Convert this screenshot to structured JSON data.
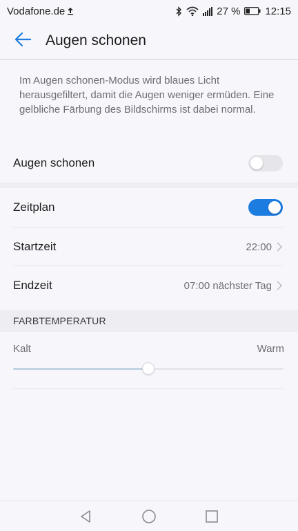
{
  "status_bar": {
    "carrier": "Vodafone.de",
    "battery_percent": "27 %",
    "time": "12:15",
    "icons": [
      "upload-icon",
      "bluetooth-icon",
      "wifi-icon",
      "signal-icon",
      "battery-icon"
    ]
  },
  "app_bar": {
    "back_icon": "arrow-left-icon",
    "title": "Augen schonen"
  },
  "description": "Im Augen schonen-Modus wird blaues Licht herausgefiltert, damit die Augen weniger ermüden. Eine gelbliche Färbung des Bildschirms ist dabei normal.",
  "settings": {
    "eye_comfort": {
      "label": "Augen schonen",
      "enabled": false
    },
    "schedule": {
      "label": "Zeitplan",
      "enabled": true
    },
    "start_time": {
      "label": "Startzeit",
      "value": "22:00"
    },
    "end_time": {
      "label": "Endzeit",
      "value": "07:00 nächster Tag"
    }
  },
  "color_temperature": {
    "header": "FARBTEMPERATUR",
    "min_label": "Kalt",
    "max_label": "Warm",
    "level": 0.5
  },
  "nav_bar": {
    "icons": [
      "back-triangle-icon",
      "home-circle-icon",
      "recents-square-icon"
    ]
  },
  "colors": {
    "accent": "#1c7ce0",
    "background": "#f7f6fb",
    "section_band": "#eeedf2"
  }
}
